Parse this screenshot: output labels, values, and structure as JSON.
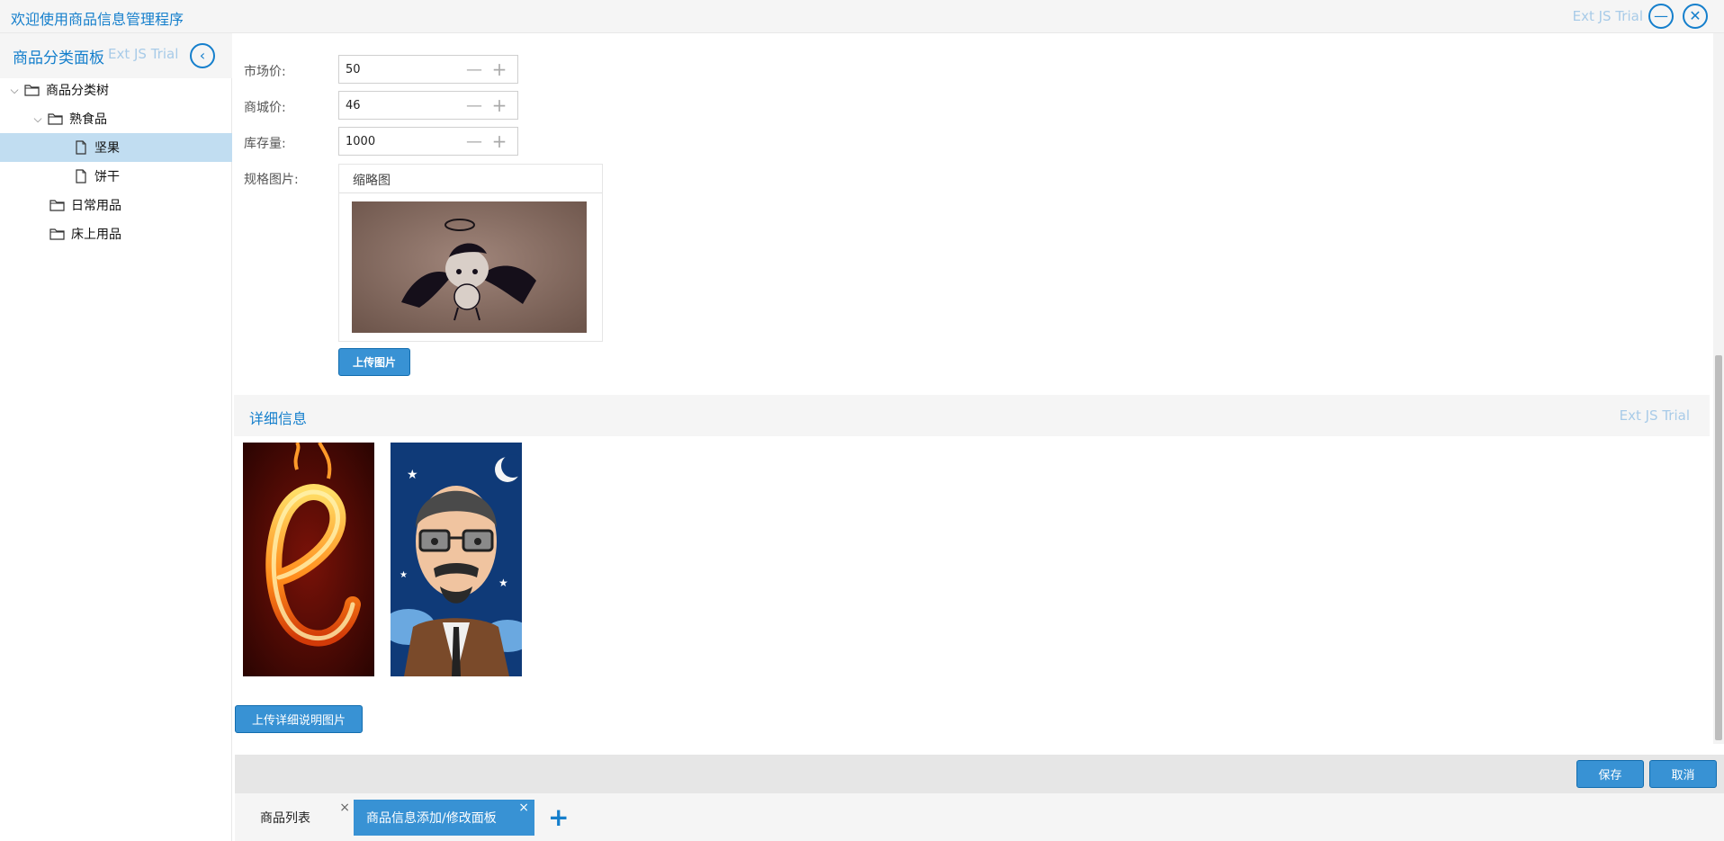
{
  "app": {
    "title": "欢迎使用商品信息管理程序",
    "trial": "Ext JS Trial"
  },
  "left_panel": {
    "title": "商品分类面板",
    "trial": "Ext JS Trial",
    "tree": [
      {
        "label": "商品分类树",
        "type": "folder",
        "expander": "⌵"
      },
      {
        "label": "熟食品",
        "type": "folder",
        "expander": "⌵"
      },
      {
        "label": "坚果",
        "type": "file",
        "selected": true
      },
      {
        "label": "饼干",
        "type": "file"
      },
      {
        "label": "日常用品",
        "type": "folder"
      },
      {
        "label": "床上用品",
        "type": "folder"
      }
    ]
  },
  "form": {
    "market_price": {
      "label": "市场价:",
      "value": "50"
    },
    "mall_price": {
      "label": "商城价:",
      "value": "46"
    },
    "stock": {
      "label": "库存量:",
      "value": "1000"
    },
    "spec_image": {
      "label": "规格图片:",
      "thumb_header": "缩略图"
    },
    "upload_button": "上传图片",
    "spin_minus": "—",
    "spin_plus": "+"
  },
  "detail": {
    "title": "详细信息",
    "trial": "Ext JS Trial",
    "upload_button": "上传详细说明图片"
  },
  "toolbar": {
    "save": "保存",
    "cancel": "取消"
  },
  "tabs": [
    {
      "label": "商品列表",
      "active": false
    },
    {
      "label": "商品信息添加/修改面板",
      "active": true
    }
  ],
  "tab_add": "+",
  "tab_close": "×",
  "colors": {
    "accent": "#157fcc",
    "button": "#3892d4",
    "selected_row": "#c1ddf1"
  }
}
